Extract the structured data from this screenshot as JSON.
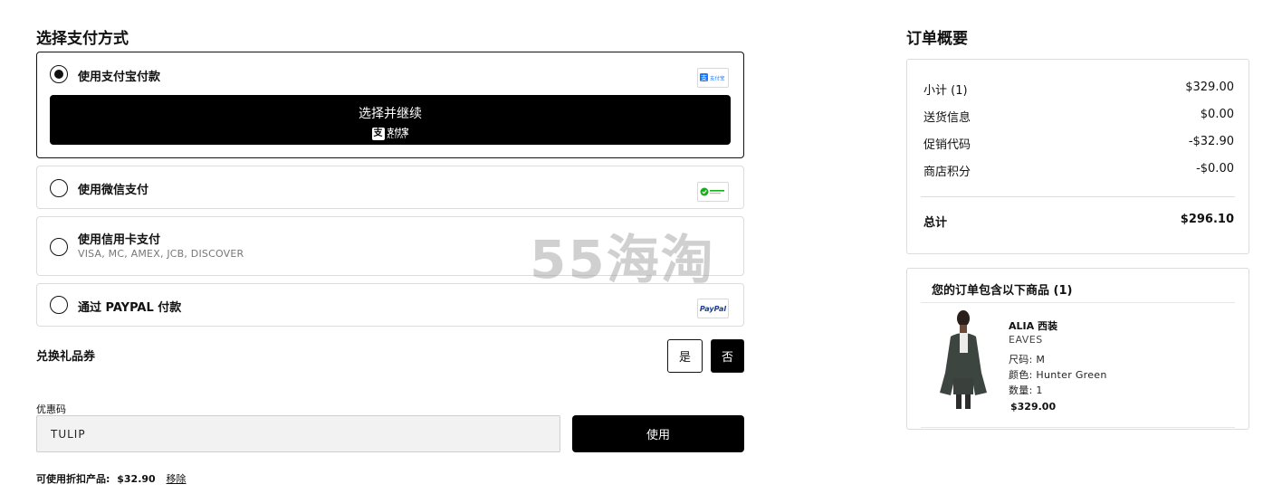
{
  "payment": {
    "title": "选择支付方式",
    "options": [
      {
        "label": "使用支付宝付款",
        "logo": "alipay-logo",
        "selected": true
      },
      {
        "label": "使用微信支付",
        "logo": "wechat-pay-logo",
        "selected": false
      },
      {
        "label": "使用信用卡支付",
        "sub": "VISA, MC, AMEX, JCB, DISCOVER",
        "selected": false
      },
      {
        "label": "通过 PAYPAL 付款",
        "logo": "paypal-logo",
        "logo_text": "PayPal",
        "selected": false
      }
    ],
    "alipay_button": {
      "label": "选择并继续",
      "mark_cn": "支付宝",
      "mark_en": "ALIPAY"
    }
  },
  "gift": {
    "label": "兑换礼品券",
    "yes": "是",
    "no": "否",
    "selected": "no"
  },
  "coupon": {
    "label": "优惠码",
    "value": "TULIP",
    "apply_label": "使用"
  },
  "discount": {
    "label": "可使用折扣产品:",
    "amount": "$32.90",
    "remove": "移除"
  },
  "watermark": "55海淘",
  "summary": {
    "title": "订单概要",
    "rows": [
      {
        "label": "小计 (1)",
        "value": "$329.00"
      },
      {
        "label": "送货信息",
        "value": "$0.00"
      },
      {
        "label": "促销代码",
        "value": "-$32.90"
      },
      {
        "label": "商店积分",
        "value": "-$0.00"
      }
    ],
    "total": {
      "label": "总计",
      "value": "$296.10"
    }
  },
  "items": {
    "title": "您的订单包含以下商品 (1)",
    "product": {
      "name": "ALIA 西装",
      "brand": "EAVES",
      "size": "尺码:  M",
      "color": "颜色:  Hunter Green",
      "qty": "数量:  1",
      "price": "$329.00"
    }
  },
  "colors": {
    "accent": "#000000",
    "border": "#dcdcdc",
    "input_bg": "#f2f2f2",
    "product": "#3d4540"
  }
}
